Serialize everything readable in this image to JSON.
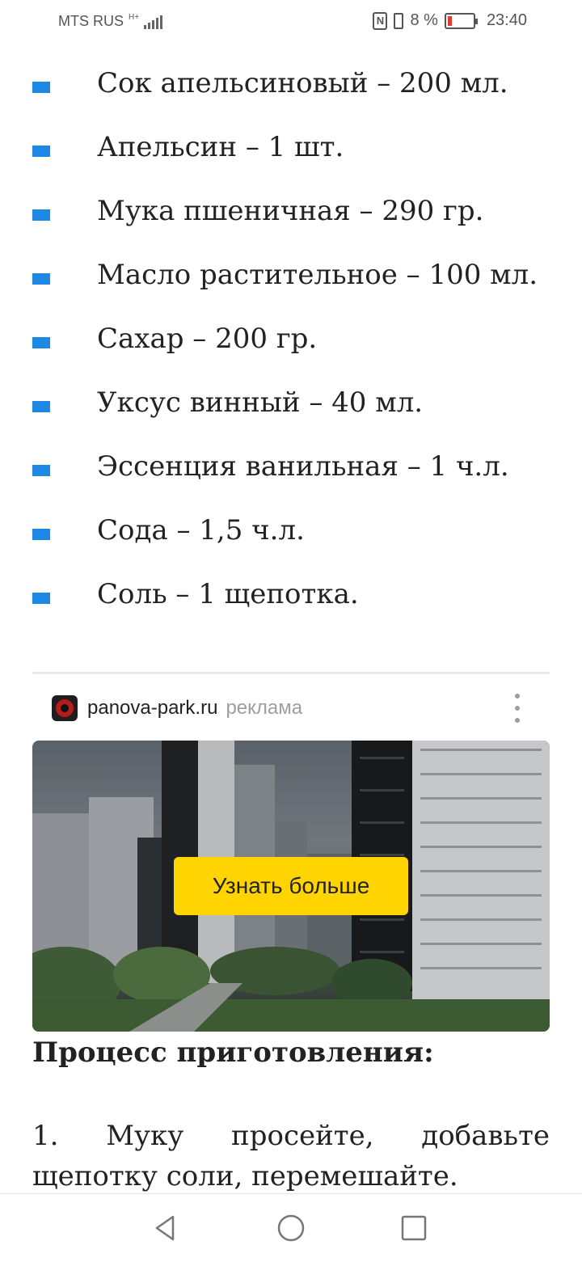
{
  "status_bar": {
    "carrier": "MTS RUS",
    "network_badge": "H+",
    "battery_percent": "8 %",
    "time": "23:40",
    "icons": [
      "signal-icon",
      "nfc-icon",
      "vibrate-icon",
      "battery-icon"
    ]
  },
  "ingredients": [
    "Сок апельсиновый – 200 мл.",
    "Апельсин – 1 шт.",
    "Мука пшеничная – 290 гр.",
    "Масло растительное – 100 мл.",
    "Сахар – 200 гр.",
    "Уксус винный – 40 мл.",
    "Эссенция ванильная – 1 ч.л.",
    "Сода – 1,5 ч.л.",
    "Соль – 1 щепотка."
  ],
  "ad": {
    "domain": "panova-park.ru",
    "label": "реклама",
    "cta": "Узнать больше"
  },
  "process": {
    "title": "Процесс приготовления:",
    "step_1": "1. Муку просейте, добавьте щепотку соли, перемешайте."
  },
  "colors": {
    "bullet": "#1e88e5",
    "cta_background": "#ffd400"
  }
}
